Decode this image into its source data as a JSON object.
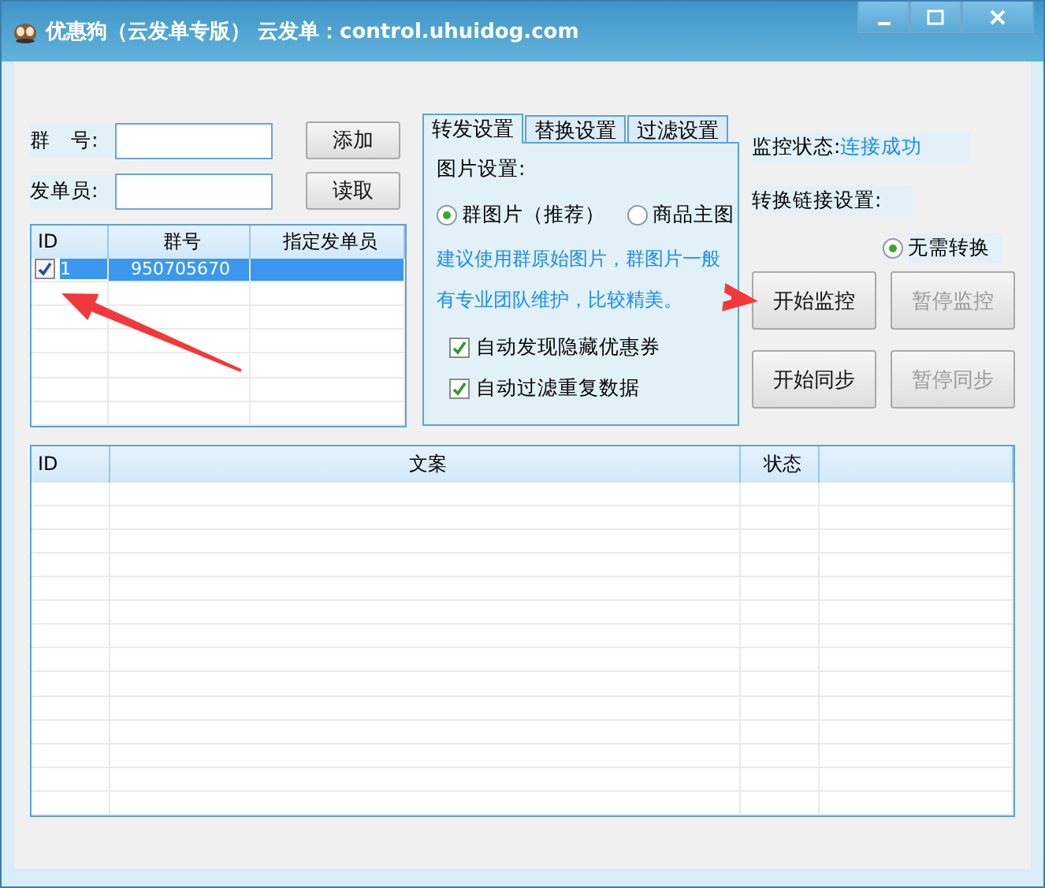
{
  "window": {
    "title": "优惠狗（云发单专版） 云发单：control.uhuidog.com"
  },
  "form": {
    "fields": [
      {
        "label": "群　号:",
        "button": "添加"
      },
      {
        "label": "发单员:",
        "button": "读取"
      }
    ]
  },
  "group_table": {
    "columns": [
      "ID",
      "群号",
      "指定发单员"
    ],
    "rows": [
      {
        "id": "1",
        "group": "950705670",
        "checked": true,
        "selected": true
      }
    ]
  },
  "tabs": [
    {
      "label": "转发设置",
      "selected": true
    },
    {
      "label": "替换设置",
      "selected": false
    },
    {
      "label": "过滤设置",
      "selected": false
    }
  ],
  "forward_settings": {
    "section_label": "图片设置:",
    "radios": [
      {
        "label": "群图片（推荐）",
        "selected": true
      },
      {
        "label": "商品主图",
        "selected": false
      }
    ],
    "hint": "建议使用群原始图片，群图片一般有专业团队维护，比较精美。",
    "checkboxes": [
      {
        "label": "自动发现隐藏优惠券",
        "checked": true
      },
      {
        "label": "自动过滤重复数据",
        "checked": true
      }
    ]
  },
  "monitor": {
    "status_label": "监控状态:",
    "status_value": "连接成功",
    "link_label": "转换链接设置:",
    "link_option": {
      "label": "无需转换",
      "selected": true
    },
    "buttons": [
      {
        "label": "开始监控",
        "disabled": false
      },
      {
        "label": "暂停监控",
        "disabled": true
      },
      {
        "label": "开始同步",
        "disabled": false
      },
      {
        "label": "暂停同步",
        "disabled": true
      }
    ]
  },
  "log_table": {
    "columns": [
      "ID",
      "文案",
      "状态"
    ]
  },
  "annotations": [
    {
      "kind": "arrow"
    },
    {
      "kind": "arrow"
    }
  ]
}
